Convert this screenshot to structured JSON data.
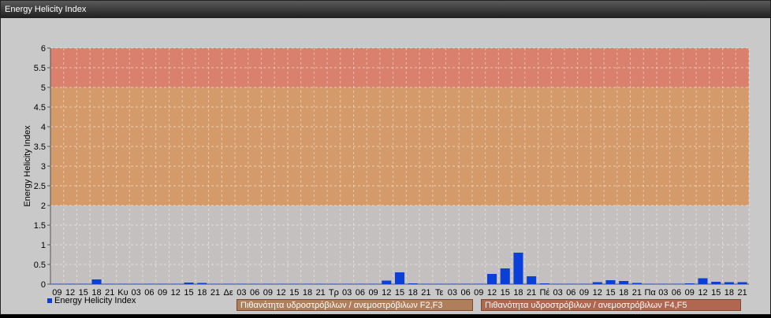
{
  "window": {
    "title": "Energy Helicity Index"
  },
  "legend": {
    "series_label": "Energy Helicity Index",
    "series_color": "#0a3fd8"
  },
  "bands": {
    "f23_label": "Πιθανότητα υδροστρόβιλων / ανεμοστρόβιλων F2,F3",
    "f45_label": "Πιθανότητα υδροστρόβιλων / ανεμοστρόβιλων F4,F5",
    "colors": {
      "low": "#c3c0bf",
      "mid": "#d49a6a",
      "high": "#d9816d"
    }
  },
  "chart_data": {
    "type": "bar",
    "title": "",
    "xlabel": "",
    "ylabel": "Energy Helicity Index",
    "ylim": [
      0,
      6
    ],
    "yticks": [
      "0",
      "0.5",
      "1",
      "1.5",
      "2",
      "2.5",
      "3",
      "3.5",
      "4",
      "4.5",
      "5",
      "5.5",
      "6"
    ],
    "grid": true,
    "legend_position": "bottom-left",
    "bands": [
      {
        "from": 0,
        "to": 2
      },
      {
        "from": 2,
        "to": 5
      },
      {
        "from": 5,
        "to": 6
      }
    ],
    "categories": [
      "09",
      "12",
      "15",
      "18",
      "21",
      "Κυ",
      "03",
      "06",
      "09",
      "12",
      "15",
      "18",
      "21",
      "Δε",
      "03",
      "06",
      "09",
      "12",
      "15",
      "18",
      "21",
      "Τρ",
      "03",
      "06",
      "09",
      "12",
      "15",
      "18",
      "21",
      "Τε",
      "03",
      "06",
      "09",
      "12",
      "15",
      "18",
      "21",
      "Πέ",
      "03",
      "06",
      "09",
      "12",
      "15",
      "18",
      "21",
      "Πα",
      "03",
      "06",
      "09",
      "12",
      "15",
      "18",
      "21"
    ],
    "series": [
      {
        "name": "Energy Helicity Index",
        "values": [
          0.01,
          0.01,
          0.01,
          0.12,
          0.01,
          0.01,
          0.01,
          0.01,
          0.01,
          0.01,
          0.04,
          0.03,
          0.01,
          0.01,
          0.01,
          0.01,
          0.01,
          0.01,
          0.01,
          0.01,
          0.01,
          0.01,
          0.01,
          0.01,
          0.01,
          0.09,
          0.3,
          0.02,
          0.01,
          0.01,
          0.01,
          0.01,
          0.01,
          0.26,
          0.4,
          0.8,
          0.2,
          0.02,
          0.01,
          0.01,
          0.01,
          0.05,
          0.1,
          0.08,
          0.03,
          0.01,
          0.01,
          0.01,
          0.02,
          0.15,
          0.06,
          0.05,
          0.05
        ]
      }
    ]
  }
}
